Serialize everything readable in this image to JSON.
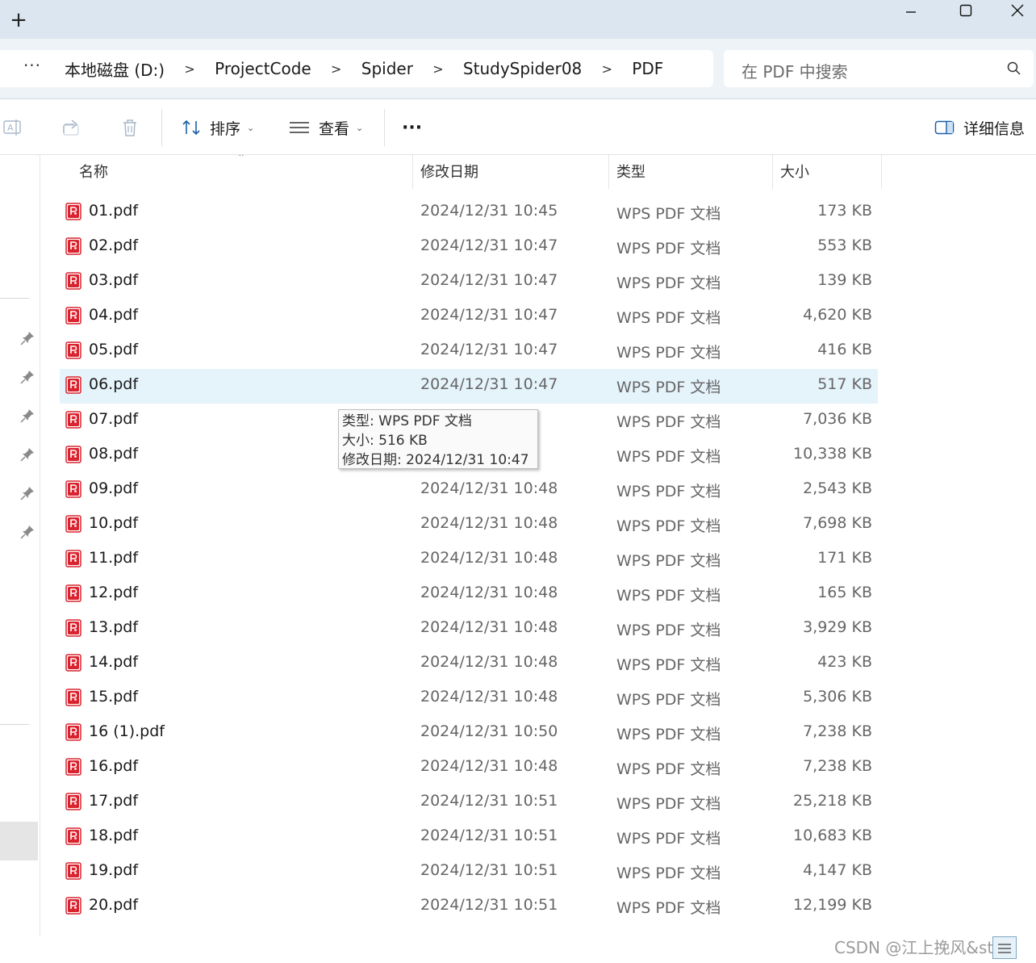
{
  "titlebar": {
    "new_tab": "+"
  },
  "address": {
    "more": "···",
    "crumbs": [
      "本地磁盘 (D:)",
      "ProjectCode",
      "Spider",
      "StudySpider08",
      "PDF"
    ],
    "separator": ">"
  },
  "search": {
    "placeholder": "在 PDF 中搜索"
  },
  "toolbar": {
    "sort_label": "排序",
    "view_label": "查看",
    "more": "···",
    "details_label": "详细信息"
  },
  "columns": {
    "name": "名称",
    "date": "修改日期",
    "type": "类型",
    "size": "大小"
  },
  "files": [
    {
      "name": "01.pdf",
      "date": "2024/12/31 10:45",
      "type": "WPS PDF 文档",
      "size": "173 KB"
    },
    {
      "name": "02.pdf",
      "date": "2024/12/31 10:47",
      "type": "WPS PDF 文档",
      "size": "553 KB"
    },
    {
      "name": "03.pdf",
      "date": "2024/12/31 10:47",
      "type": "WPS PDF 文档",
      "size": "139 KB"
    },
    {
      "name": "04.pdf",
      "date": "2024/12/31 10:47",
      "type": "WPS PDF 文档",
      "size": "4,620 KB"
    },
    {
      "name": "05.pdf",
      "date": "2024/12/31 10:47",
      "type": "WPS PDF 文档",
      "size": "416 KB"
    },
    {
      "name": "06.pdf",
      "date": "2024/12/31 10:47",
      "type": "WPS PDF 文档",
      "size": "517 KB"
    },
    {
      "name": "07.pdf",
      "date": "",
      "type": "WPS PDF 文档",
      "size": "7,036 KB"
    },
    {
      "name": "08.pdf",
      "date": "",
      "type": "WPS PDF 文档",
      "size": "10,338 KB"
    },
    {
      "name": "09.pdf",
      "date": "2024/12/31 10:48",
      "type": "WPS PDF 文档",
      "size": "2,543 KB"
    },
    {
      "name": "10.pdf",
      "date": "2024/12/31 10:48",
      "type": "WPS PDF 文档",
      "size": "7,698 KB"
    },
    {
      "name": "11.pdf",
      "date": "2024/12/31 10:48",
      "type": "WPS PDF 文档",
      "size": "171 KB"
    },
    {
      "name": "12.pdf",
      "date": "2024/12/31 10:48",
      "type": "WPS PDF 文档",
      "size": "165 KB"
    },
    {
      "name": "13.pdf",
      "date": "2024/12/31 10:48",
      "type": "WPS PDF 文档",
      "size": "3,929 KB"
    },
    {
      "name": "14.pdf",
      "date": "2024/12/31 10:48",
      "type": "WPS PDF 文档",
      "size": "423 KB"
    },
    {
      "name": "15.pdf",
      "date": "2024/12/31 10:48",
      "type": "WPS PDF 文档",
      "size": "5,306 KB"
    },
    {
      "name": "16 (1).pdf",
      "date": "2024/12/31 10:50",
      "type": "WPS PDF 文档",
      "size": "7,238 KB"
    },
    {
      "name": "16.pdf",
      "date": "2024/12/31 10:48",
      "type": "WPS PDF 文档",
      "size": "7,238 KB"
    },
    {
      "name": "17.pdf",
      "date": "2024/12/31 10:51",
      "type": "WPS PDF 文档",
      "size": "25,218 KB"
    },
    {
      "name": "18.pdf",
      "date": "2024/12/31 10:51",
      "type": "WPS PDF 文档",
      "size": "10,683 KB"
    },
    {
      "name": "19.pdf",
      "date": "2024/12/31 10:51",
      "type": "WPS PDF 文档",
      "size": "4,147 KB"
    },
    {
      "name": "20.pdf",
      "date": "2024/12/31 10:51",
      "type": "WPS PDF 文档",
      "size": "12,199 KB"
    }
  ],
  "selected_row": 5,
  "tooltip": {
    "line1": "类型: WPS PDF 文档",
    "line2": "大小: 516 KB",
    "line3": "修改日期: 2024/12/31 10:47"
  },
  "watermark": "CSDN @江上挽风&sty",
  "colors": {
    "pdf_icon": "#d9232e",
    "selection": "#e5f3fb",
    "titlebar": "#dbe6f0"
  }
}
